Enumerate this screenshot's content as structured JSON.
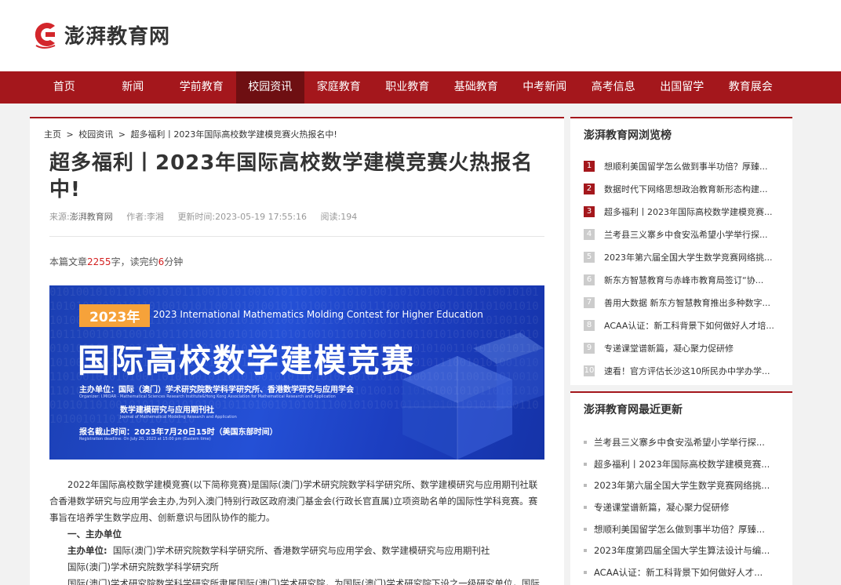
{
  "site": {
    "name": "澎湃教育网",
    "logo_icon": "c-brand-logo"
  },
  "nav": [
    {
      "label": "首页"
    },
    {
      "label": "新闻"
    },
    {
      "label": "学前教育"
    },
    {
      "label": "校园资讯",
      "active": true
    },
    {
      "label": "家庭教育"
    },
    {
      "label": "职业教育"
    },
    {
      "label": "基础教育"
    },
    {
      "label": "中考新闻"
    },
    {
      "label": "高考信息"
    },
    {
      "label": "出国留学"
    },
    {
      "label": "教育展会"
    }
  ],
  "breadcrumb": {
    "home": "主页",
    "sep": ">",
    "section": "校园资讯",
    "current": "超多福利丨2023年国际高校数学建模竞赛火热报名中!"
  },
  "article": {
    "title": "超多福利丨2023年国际高校数学建模竞赛火热报名中!",
    "source_label": "来源:",
    "source": "澎湃教育网",
    "author_label": "作者:",
    "author": "李湘",
    "updated_label": "更新时间:",
    "updated": "2023-05-19 17:55:16",
    "views_label": "阅读:",
    "views": "194",
    "read_prefix": "本篇文章",
    "word_count": "2255",
    "read_mid": "字，读完约",
    "minutes": "6",
    "read_suffix": "分钟",
    "banner": {
      "year": "2023年",
      "en_title": "2023 International Mathematics Molding Contest for Higher Education",
      "cn_title": "国际高校数学建模竞赛",
      "organizer": "主办单位：国际（澳门）学术研究院数学科学研究所、香港数学研究与应用学会",
      "organizer_en": "Organizer: I.MIOAR · Mathematical Sciences Research Institute&Hong Kong Association for Mathematical Research and Application",
      "journal": "数学建模研究与应用期刊社",
      "journal_en": "Journal of Mathematical Modeling Research and Application",
      "deadline": "报名截止时间：2023年7月20日15时（美国东部时间）",
      "deadline_en": "Registration deadline: On July 20, 2023 at 15:00 pm (Eastern time)"
    },
    "paragraph1": "2022年国际高校数学建模竞赛(以下简称竞赛)是国际(澳门)学术研究院数学科学研究所、数学建模研究与应用期刊社联合香港数学研究与应用学会主办,为列入澳门特别行政区政府澳门基金会(行政长官直属)立项资助名单的国际性学科竞赛。赛事旨在培养学生数学应用、创新意识与团队协作的能力。",
    "section_heading": "一、主办单位",
    "host_label": "主办单位:",
    "host_text": "国际(澳门)学术研究院数学科学研究所、香港数学研究与应用学会、数学建模研究与应用期刊社",
    "host_line2": "国际(澳门)学术研究院数学科学研究所",
    "host_line3": "国际(澳门)学术研究院数学科学研究所隶属国际(澳门)学术研究院，为国际(澳门)学术研究院下设之一级研究单位，国际"
  },
  "sidebar_top": {
    "title": "澎湃教育网浏览榜",
    "items": [
      {
        "n": "1",
        "text": "想顺利美国留学怎么做到事半功倍？厚臻..."
      },
      {
        "n": "2",
        "text": "数据时代下网络思想政治教育新形态构建..."
      },
      {
        "n": "3",
        "text": "超多福利丨2023年国际高校数学建模竞赛..."
      },
      {
        "n": "4",
        "text": "兰考县三义寨乡中食安泓希望小学举行探..."
      },
      {
        "n": "5",
        "text": "2023年第六届全国大学生数学竞赛网络挑..."
      },
      {
        "n": "6",
        "text": "新东方智慧教育与赤峰市教育局签订“协..."
      },
      {
        "n": "7",
        "text": "善用大数据 新东方智慧教育推出多种数字..."
      },
      {
        "n": "8",
        "text": "ACAA认证：新工科背景下如何做好人才培..."
      },
      {
        "n": "9",
        "text": "专递课堂谱新篇，凝心聚力促研修"
      },
      {
        "n": "10",
        "text": "速看！官方评估长沙这10所民办中学办学..."
      }
    ]
  },
  "sidebar_recent": {
    "title": "澎湃教育网最近更新",
    "items": [
      {
        "text": "兰考县三义寨乡中食安泓希望小学举行探..."
      },
      {
        "text": "超多福利丨2023年国际高校数学建模竞赛..."
      },
      {
        "text": "2023年第六届全国大学生数学竞赛网络挑..."
      },
      {
        "text": "专递课堂谱新篇，凝心聚力促研修"
      },
      {
        "text": "想顺利美国留学怎么做到事半功倍？厚臻..."
      },
      {
        "text": "2023年度第四届全国大学生算法设计与编..."
      },
      {
        "text": "ACAA认证：新工科背景下如何做好人才..."
      }
    ]
  },
  "colors": {
    "brand_red": "#a4171c",
    "nav_active": "#6e0f12",
    "accent_orange": "#f6a23a",
    "banner_blue": "#2450d6"
  }
}
